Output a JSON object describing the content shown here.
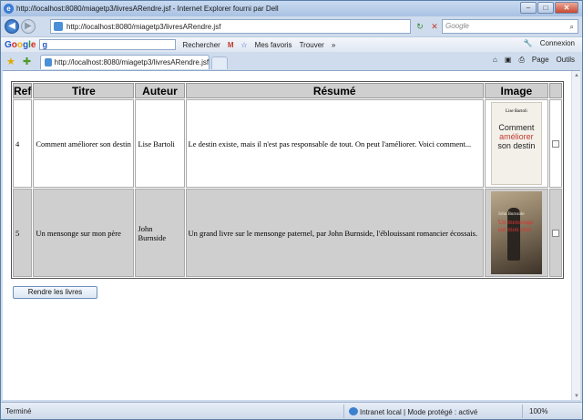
{
  "window": {
    "title": "http://localhost:8080/miagetp3/livresARendre.jsf - Internet Explorer fourni par Dell"
  },
  "address_bar": {
    "url": "http://localhost:8080/miagetp3/livresARendre.jsf",
    "search_placeholder": "Google"
  },
  "google_toolbar": {
    "logo": "Google",
    "search_label": "Rechercher",
    "favorites_label": "Mes favoris",
    "find_label": "Trouver",
    "more_label": "»",
    "connect_label": "Connexion"
  },
  "tab": {
    "title": "http://localhost:8080/miagetp3/livresARendre.jsf"
  },
  "command_bar": {
    "page_label": "Page",
    "tools_label": "Outils"
  },
  "table": {
    "headers": [
      "Ref",
      "Titre",
      "Auteur",
      "Résumé",
      "Image"
    ],
    "rows": [
      {
        "ref": "4",
        "title": "Comment améliorer son destin",
        "author": "Lise Bartoli",
        "summary": "Le destin existe, mais il n'est pas responsable de tout. On peut l'améliorer. Voici comment...",
        "cover": {
          "author": "Lise Bartoli",
          "title_line1": "Comment",
          "title_line2": "améliorer",
          "title_line3": "son destin"
        },
        "checked": false
      },
      {
        "ref": "5",
        "title": "Un mensonge sur mon père",
        "author": "John Burnside",
        "summary": "Un grand livre sur le mensonge paternel, par John Burnside, l'éblouissant romancier écossais.",
        "cover": {
          "author": "John Burnside",
          "title": "Un mensonge sur mon père"
        },
        "checked": false
      }
    ]
  },
  "actions": {
    "return_button": "Rendre les livres"
  },
  "status_bar": {
    "left": "Terminé",
    "zone": "Intranet local | Mode protégé : activé",
    "zoom": "100%"
  }
}
